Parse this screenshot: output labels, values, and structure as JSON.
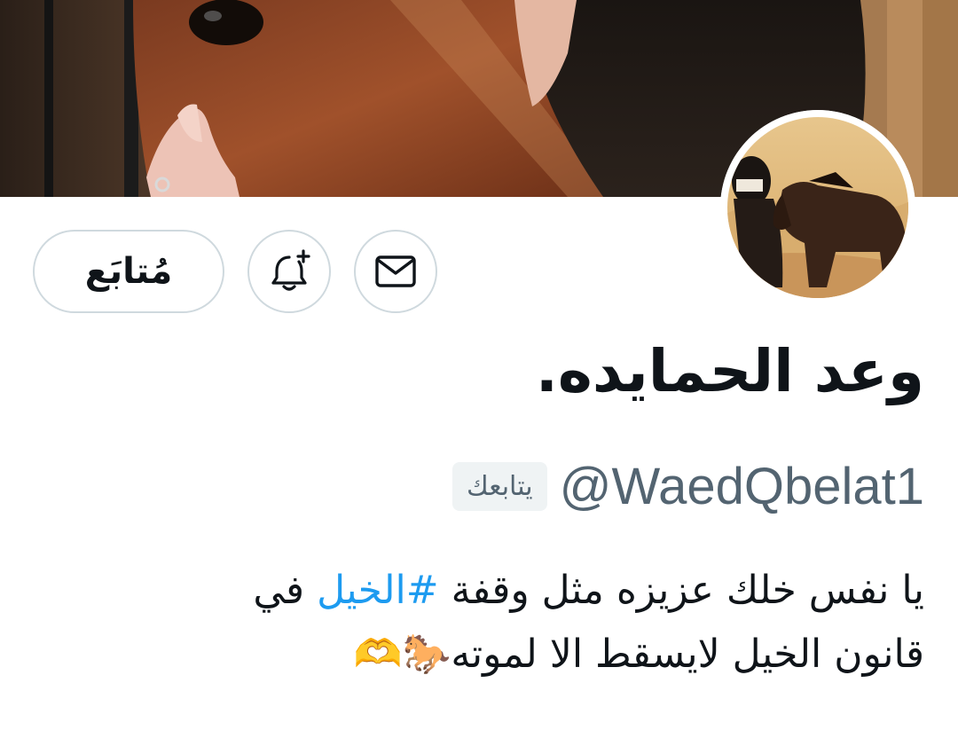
{
  "profile": {
    "display_name": "وعد الحمايده.",
    "handle": "@WaedQbelat1",
    "follows_you_badge": "يتابعك",
    "bio": {
      "line1_before": "يا نفس خلك عزيزه مثل وقفة",
      "hashtag": "#الخيل",
      "line1_after": "في",
      "line2": "قانون الخيل لايسقط الا لموته",
      "emoji": "🐎🫶"
    }
  },
  "actions": {
    "follow_label": "مُتابَع",
    "notify_icon": "bell-plus-icon",
    "message_icon": "envelope-icon"
  },
  "colors": {
    "text_primary": "#0f1419",
    "text_secondary": "#536471",
    "hashtag": "#1d9bf0",
    "button_border": "#cfd9de",
    "badge_bg": "#eff3f4"
  }
}
